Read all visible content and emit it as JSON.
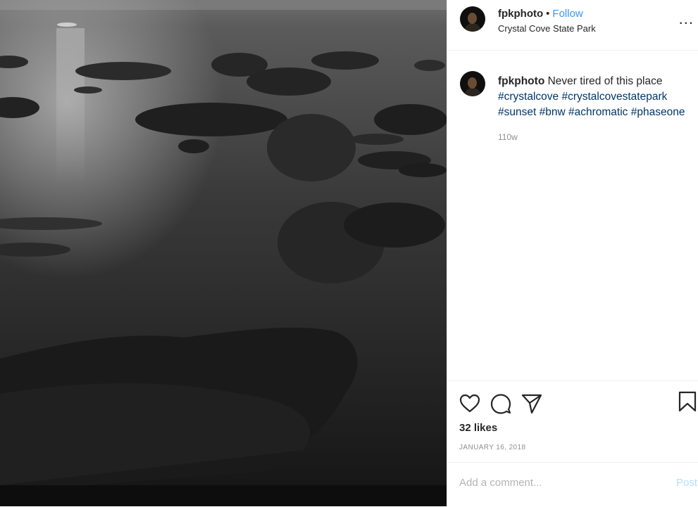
{
  "header": {
    "username": "fpkphoto",
    "separator": "•",
    "follow_label": "Follow",
    "location": "Crystal Cove State Park",
    "more_label": "..."
  },
  "caption": {
    "username": "fpkphoto",
    "text": "Never tired of this place",
    "hashtags": [
      "#crystalcove",
      "#crystalcovestatepark",
      "#sunset",
      "#bnw",
      "#achromatic",
      "#phaseone"
    ],
    "time_ago": "110w"
  },
  "stats": {
    "likes": "32 likes",
    "date": "JANUARY 16, 2018"
  },
  "comment": {
    "placeholder": "Add a comment...",
    "post_label": "Post"
  },
  "icons": {
    "like": "heart-icon",
    "comment": "comment-bubble-icon",
    "share": "paper-plane-icon",
    "save": "bookmark-icon",
    "more": "ellipsis-icon"
  },
  "colors": {
    "link": "#3897f0",
    "hashtag": "#00376b",
    "post_disabled": "#b2dffc",
    "muted": "#8e8e8e"
  },
  "photo": {
    "description_icon": "photo-image"
  }
}
